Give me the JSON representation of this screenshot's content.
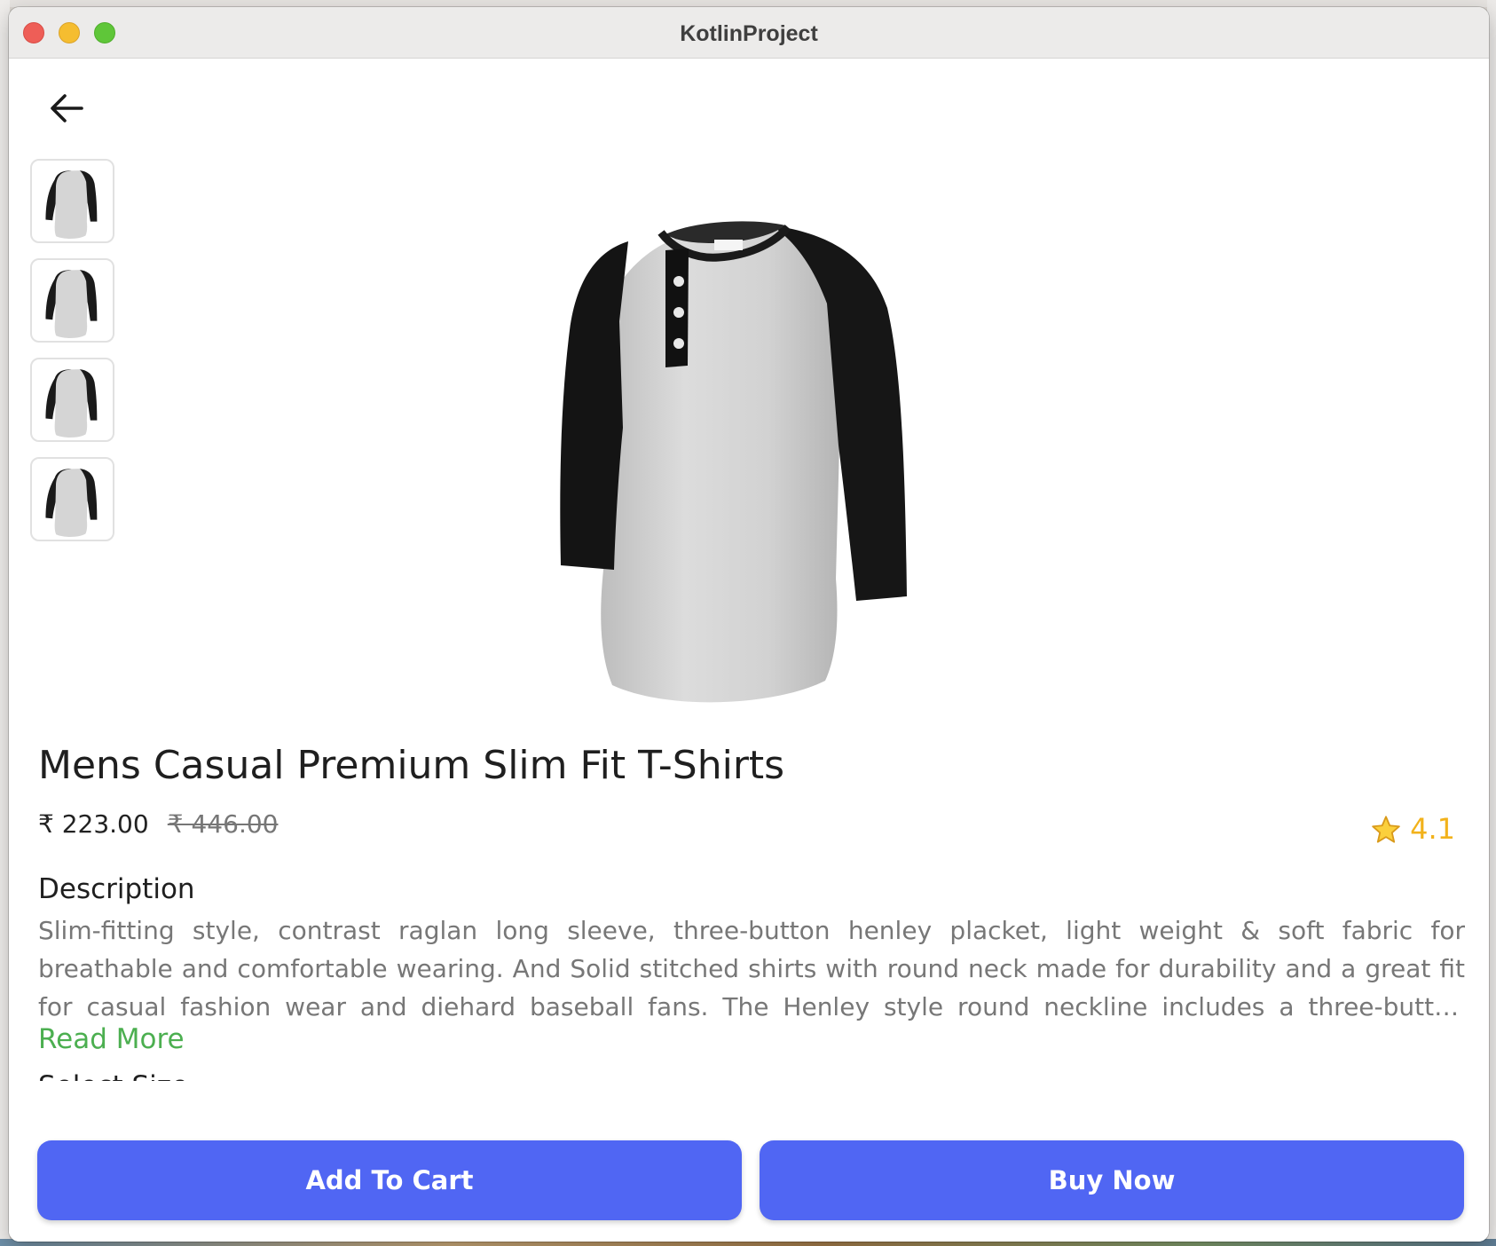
{
  "window": {
    "title": "KotlinProject"
  },
  "nav": {
    "back_icon": "arrow-left-icon"
  },
  "gallery": {
    "thumbnails": [
      {
        "alt": "product-thumbnail"
      },
      {
        "alt": "product-thumbnail"
      },
      {
        "alt": "product-thumbnail"
      },
      {
        "alt": "product-thumbnail"
      }
    ]
  },
  "product": {
    "title": "Mens Casual Premium Slim Fit T-Shirts",
    "price": "₹ 223.00",
    "original_price": "₹ 446.00",
    "rating": "4.1",
    "rating_icon": "star-icon",
    "description_heading": "Description",
    "description": "Slim-fitting style, contrast raglan long sleeve, three-button henley placket, light weight & soft fabric for breathable and comfortable wearing. And Solid stitched shirts with round neck made for durability and a great fit for casual fashion wear and diehard baseball fans. The Henley style round neckline includes a three-button placket.",
    "read_more": "Read More",
    "select_size_heading": "Select Size"
  },
  "actions": {
    "add_to_cart": "Add To Cart",
    "buy_now": "Buy Now"
  },
  "colors": {
    "primary_button": "#5066f3",
    "read_more": "#4caf50",
    "rating": "#f2b21b"
  }
}
